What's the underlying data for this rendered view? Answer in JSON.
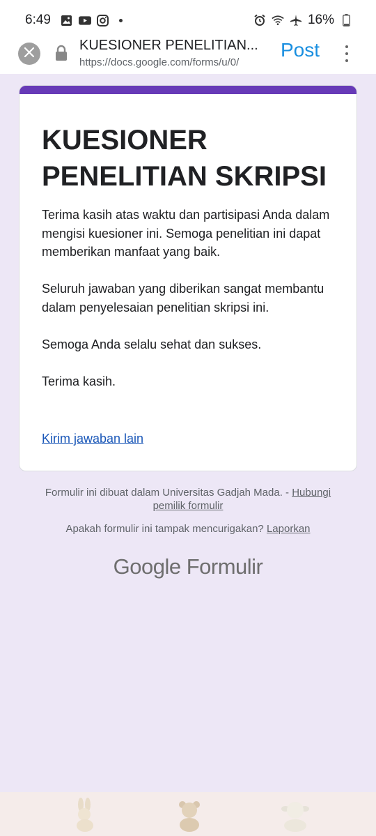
{
  "status_bar": {
    "time": "6:49",
    "battery": "16%"
  },
  "toolbar": {
    "title": "KUESIONER PENELITIAN...",
    "url": "https://docs.google.com/forms/u/0/",
    "post_label": "Post"
  },
  "form": {
    "accent_color": "#673ab7",
    "title_line1": "KUESIONER",
    "title_line2": "PENELITIAN SKRIPSI",
    "paragraphs": [
      "Terima kasih atas waktu dan partisipasi Anda dalam mengisi kuesioner ini. Semoga penelitian ini dapat memberikan manfaat yang baik.",
      "Seluruh jawaban yang diberikan sangat membantu dalam penyelesaian penelitian skripsi ini.",
      "Semoga Anda selalu sehat dan sukses.",
      "Terima kasih."
    ],
    "another_response_link": "Kirim jawaban lain"
  },
  "footer": {
    "note_prefix": "Formulir ini dibuat dalam Universitas Gadjah Mada. - ",
    "contact_link": "Hubungi pemilik formulir",
    "report_prefix": "Apakah formulir ini tampak mencurigakan? ",
    "report_link": "Laporkan",
    "brand_google": "Google",
    "brand_product": "Formulir"
  }
}
